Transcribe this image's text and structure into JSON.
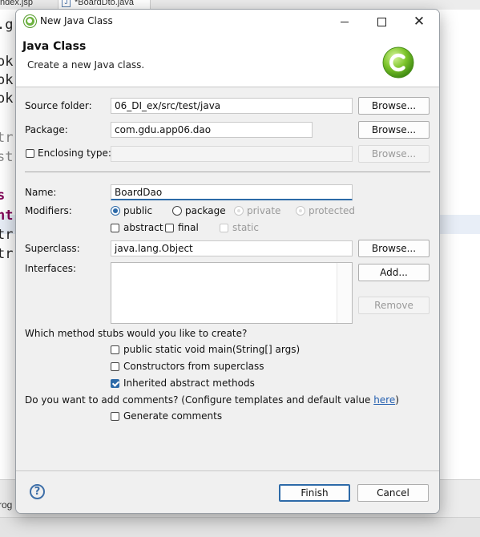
{
  "background": {
    "tabs": [
      {
        "label": "ndex.jsp"
      },
      {
        "label": "*BoardDto.java",
        "icon": "java-file-icon"
      }
    ],
    "code_fragments": [
      ".g",
      "ok",
      "ok",
      "ok",
      "tr",
      "st",
      "s",
      "nt",
      "tr",
      "tr"
    ],
    "bottom_text": "rog"
  },
  "dialog": {
    "window_title": "New Java Class",
    "header": {
      "title": "Java Class",
      "description": "Create a new Java class."
    },
    "source_folder": {
      "label": "Source folder:",
      "value": "06_DI_ex/src/test/java",
      "browse_label": "Browse..."
    },
    "package": {
      "label": "Package:",
      "value": "com.gdu.app06.dao",
      "browse_label": "Browse..."
    },
    "enclosing_type": {
      "label": "Enclosing type:",
      "checked": false,
      "value": "",
      "browse_label": "Browse..."
    },
    "name": {
      "label": "Name:",
      "value": "BoardDao"
    },
    "modifiers": {
      "label": "Modifiers:",
      "access": [
        {
          "label": "public",
          "selected": true,
          "enabled": true
        },
        {
          "label": "package",
          "selected": false,
          "enabled": true
        },
        {
          "label": "private",
          "selected": false,
          "enabled": false
        },
        {
          "label": "protected",
          "selected": false,
          "enabled": false
        }
      ],
      "flags": [
        {
          "label": "abstract",
          "checked": false,
          "enabled": true
        },
        {
          "label": "final",
          "checked": false,
          "enabled": true
        },
        {
          "label": "static",
          "checked": false,
          "enabled": false
        }
      ]
    },
    "superclass": {
      "label": "Superclass:",
      "value": "java.lang.Object",
      "browse_label": "Browse..."
    },
    "interfaces": {
      "label": "Interfaces:",
      "add_label": "Add...",
      "remove_label": "Remove",
      "items": []
    },
    "method_stubs": {
      "question": "Which method stubs would you like to create?",
      "options": [
        {
          "label": "public static void main(String[] args)",
          "checked": false
        },
        {
          "label": "Constructors from superclass",
          "checked": false
        },
        {
          "label": "Inherited abstract methods",
          "checked": true
        }
      ]
    },
    "comments": {
      "question_prefix": "Do you want to add comments? (Configure templates and default value ",
      "link_text": "here",
      "question_suffix": ")",
      "option_label": "Generate comments",
      "checked": false
    },
    "footer": {
      "finish_label": "Finish",
      "cancel_label": "Cancel"
    },
    "colors": {
      "accent": "#2d6aa8",
      "link": "#2560b0",
      "spring_green": "#6db33f"
    }
  }
}
